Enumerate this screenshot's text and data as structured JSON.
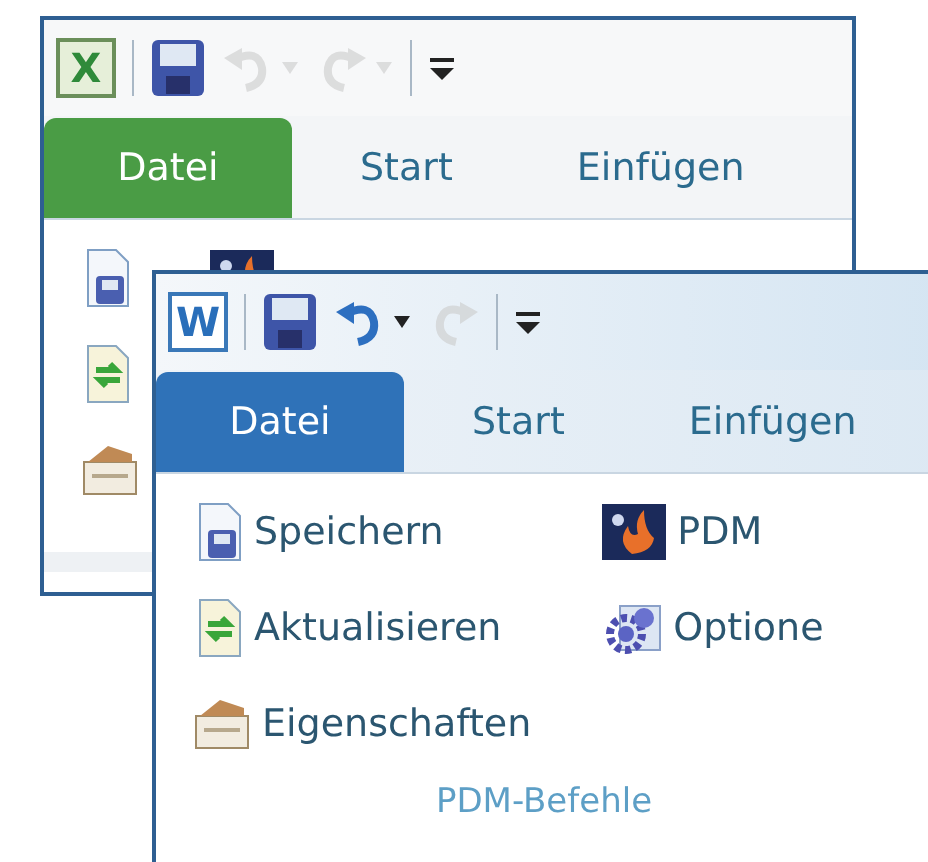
{
  "windows": [
    {
      "kind": "excel",
      "logo": "X",
      "quick_access": [
        {
          "kind": "save",
          "disabled": false,
          "dropdown": false
        },
        {
          "kind": "undo",
          "disabled": true,
          "dropdown": true
        },
        {
          "kind": "redo",
          "disabled": true,
          "dropdown": true
        },
        {
          "kind": "customize",
          "disabled": false,
          "dropdown": false
        }
      ],
      "tabs": [
        {
          "label": "Datei",
          "kind": "file"
        },
        {
          "label": "Start",
          "kind": "tab"
        },
        {
          "label": "Einfügen",
          "kind": "tab"
        }
      ],
      "columns": [
        [
          {
            "kind": "document-save"
          },
          {
            "kind": "refresh"
          },
          {
            "kind": "properties"
          }
        ],
        [
          {
            "kind": "pdm"
          }
        ]
      ]
    },
    {
      "kind": "word",
      "logo": "W",
      "quick_access": [
        {
          "kind": "save",
          "disabled": false,
          "dropdown": false
        },
        {
          "kind": "undo",
          "disabled": false,
          "dropdown": true
        },
        {
          "kind": "redo",
          "disabled": true,
          "dropdown": false
        },
        {
          "kind": "customize",
          "disabled": false,
          "dropdown": false
        }
      ],
      "tabs": [
        {
          "label": "Datei",
          "kind": "file"
        },
        {
          "label": "Start",
          "kind": "tab"
        },
        {
          "label": "Einfügen",
          "kind": "tab"
        }
      ],
      "columns": [
        [
          {
            "kind": "document-save",
            "label": "Speichern"
          },
          {
            "kind": "refresh",
            "label": "Aktualisieren"
          },
          {
            "kind": "properties",
            "label": "Eigenschaften"
          }
        ],
        [
          {
            "kind": "pdm",
            "label": "PDM"
          },
          {
            "kind": "options",
            "label": "Optione"
          }
        ]
      ],
      "group_label": "PDM-Befehle"
    }
  ]
}
